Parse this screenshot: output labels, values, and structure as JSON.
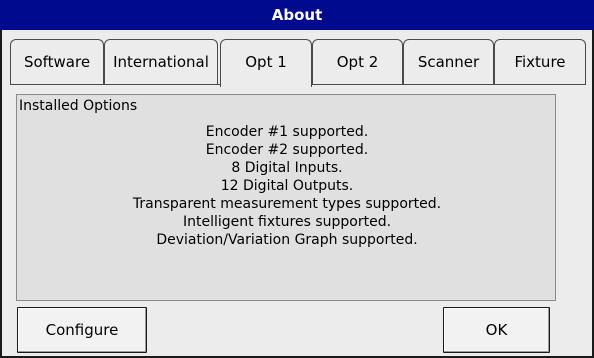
{
  "window": {
    "title": "About"
  },
  "tabs": [
    {
      "label": "Software",
      "active": false
    },
    {
      "label": "International",
      "active": false
    },
    {
      "label": "Opt 1",
      "active": true
    },
    {
      "label": "Opt 2",
      "active": false
    },
    {
      "label": "Scanner",
      "active": false
    },
    {
      "label": "Fixture",
      "active": false
    }
  ],
  "panel": {
    "title": "Installed Options",
    "items": [
      "Encoder #1 supported.",
      "Encoder #2 supported.",
      "8 Digital Inputs.",
      "12 Digital Outputs.",
      "Transparent measurement types supported.",
      "Intelligent fixtures supported.",
      "Deviation/Variation Graph supported."
    ]
  },
  "buttons": {
    "configure_label": "Configure",
    "ok_label": "OK"
  },
  "colors": {
    "titlebar": "#000a8c",
    "background": "#ececec"
  }
}
